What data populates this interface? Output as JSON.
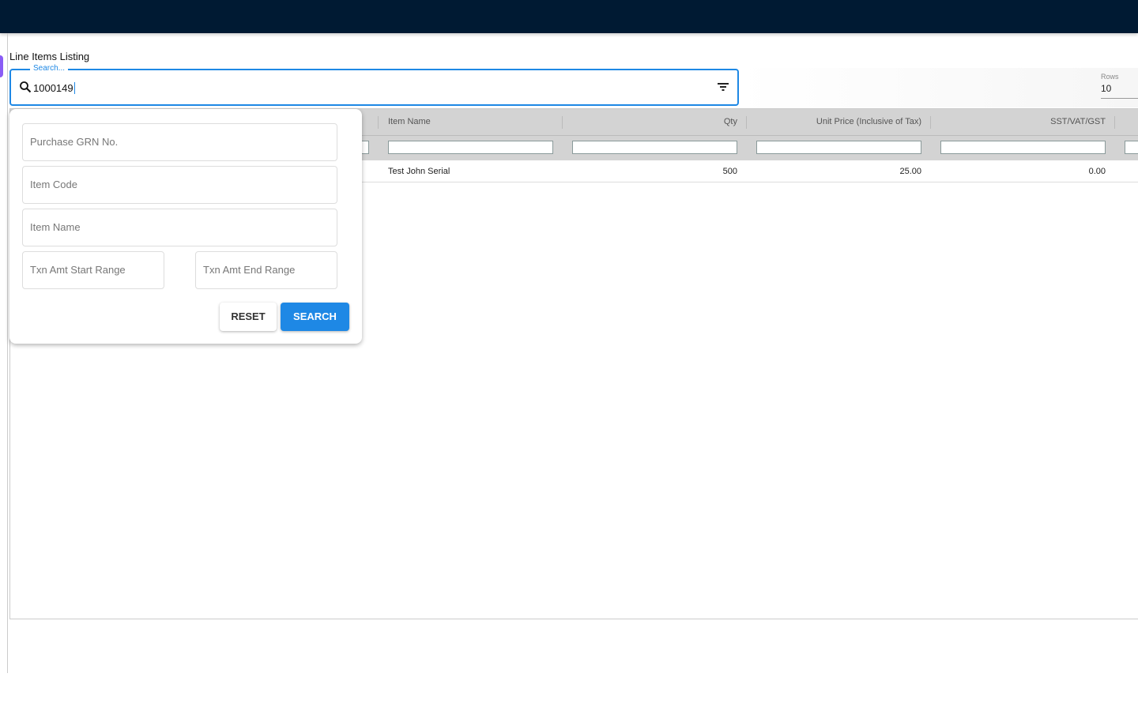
{
  "page": {
    "title": "Line Items Listing"
  },
  "search": {
    "label": "Search...",
    "value": "1000149"
  },
  "rows": {
    "label": "Rows",
    "value": "10"
  },
  "table": {
    "columns": [
      "Item Name",
      "Qty",
      "Unit Price (Inclusive of Tax)",
      "SST/VAT/GST"
    ],
    "rows": [
      {
        "item_name": "Test John Serial",
        "qty": "500",
        "unit_price": "25.00",
        "tax": "0.00"
      }
    ]
  },
  "filter_panel": {
    "purchase_grn": "Purchase GRN No.",
    "item_code": "Item Code",
    "item_name": "Item Name",
    "txn_start": "Txn Amt Start Range",
    "txn_end": "Txn Amt End Range",
    "reset": "RESET",
    "search": "SEARCH"
  },
  "colors": {
    "topbar": "#001a33",
    "accent": "#1e88e5"
  }
}
